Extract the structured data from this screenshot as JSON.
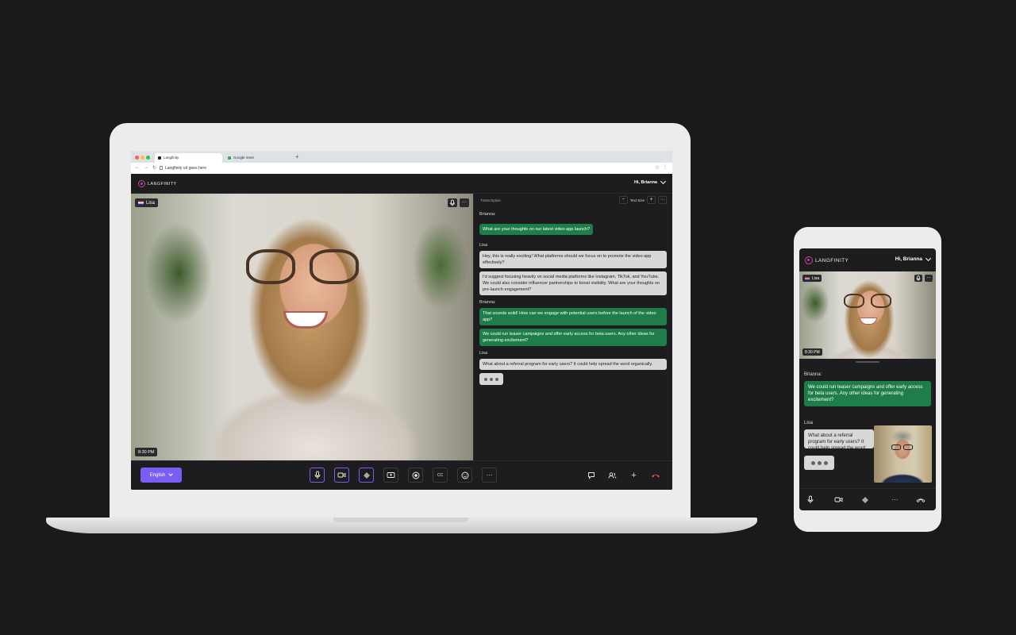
{
  "browser": {
    "tabs": [
      {
        "label": "Langfinity"
      },
      {
        "label": "Google meet"
      }
    ],
    "new_tab": "+",
    "url": "Langfinity url goes here"
  },
  "app": {
    "logo_text": "LANGFINITY",
    "greeting": "Hi, Brianna",
    "accent_color": "#7b5cf5",
    "brand_color": "#e0457b"
  },
  "video": {
    "participant_name": "Lisa",
    "timestamp": "8:30 PM"
  },
  "panel": {
    "title": "Transcription",
    "text_size_label": "Text Size",
    "decrease": "−",
    "increase": "+",
    "more": "···"
  },
  "messages": [
    {
      "speaker": "Brianna:",
      "bubbles": [
        "What are your thoughts on our latest video app launch?"
      ]
    },
    {
      "speaker": "Lisa",
      "bubbles": [
        "Hey, this is really exciting! What platforms should we focus on to promote the video app effectively?",
        "I'd suggest focusing heavily on social media platforms like Instagram, TikTok, and YouTube. We could also consider influencer partnerships to boost visibility. What are your thoughts on pre-launch engagement?"
      ]
    },
    {
      "speaker": "Brianna:",
      "bubbles": [
        "That sounds solid! How can we engage with potential users before the launch of the video app?",
        "We could run teaser campaigns and offer early access for beta users. Any other ideas for generating excitement?"
      ]
    },
    {
      "speaker": "Lisa",
      "bubbles": [
        "What about a referral program for early users? It could help spread the word organically."
      ]
    }
  ],
  "toolbar": {
    "language": "English",
    "icons": [
      "mic-icon",
      "camera-icon",
      "translate-icon",
      "share-screen-icon",
      "record-icon",
      "captions-icon",
      "emoji-icon",
      "more-icon",
      "chat-icon",
      "participants-icon",
      "add-icon",
      "end-call-icon"
    ],
    "more_label": "···",
    "add_label": "+",
    "captions_label": "CC"
  },
  "phone": {
    "logo_text": "LANGFINITY",
    "greeting": "Hi, Brianna",
    "participant_name": "Lisa",
    "timestamp": "8:30 PM",
    "messages": [
      {
        "speaker": "Brianna:",
        "text": "We could run teaser campaigns and offer early access for beta users. Any other ideas for generating excitement?"
      },
      {
        "speaker": "Lisa",
        "text": "What about a referral program for early users? It could help spread the word organically."
      }
    ],
    "more_label": "···"
  }
}
